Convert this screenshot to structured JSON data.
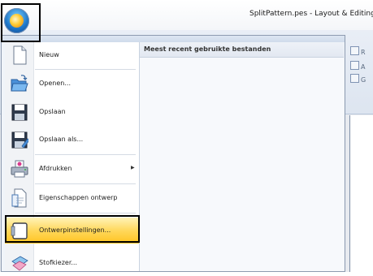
{
  "window": {
    "title": "SplitPattern.pes - Layout & Editing"
  },
  "ribbon": {
    "commands": [
      "R",
      "A",
      "G"
    ],
    "partial_label": "g"
  },
  "app_menu": {
    "recent_title": "Meest recent gebruikte bestanden",
    "items": [
      {
        "label": "Nieuw",
        "icon": "new-document-icon"
      },
      {
        "label": "Openen...",
        "icon": "open-folder-icon"
      },
      {
        "label": "Opslaan",
        "icon": "save-disk-icon"
      },
      {
        "label": "Opslaan als...",
        "icon": "save-as-icon"
      },
      {
        "label": "Afdrukken",
        "icon": "printer-icon",
        "has_submenu": true
      },
      {
        "label": "Eigenschappen ontwerp",
        "icon": "design-properties-icon"
      },
      {
        "label": "Ontwerpinstellingen...",
        "icon": "design-settings-icon",
        "highlighted": true
      },
      {
        "label": "Stofkiezer...",
        "icon": "fabric-selector-icon"
      }
    ]
  },
  "colors": {
    "highlight": "#ffd85c",
    "menu_bg": "#f0f4f9",
    "accent_blue": "#1f78c9"
  }
}
